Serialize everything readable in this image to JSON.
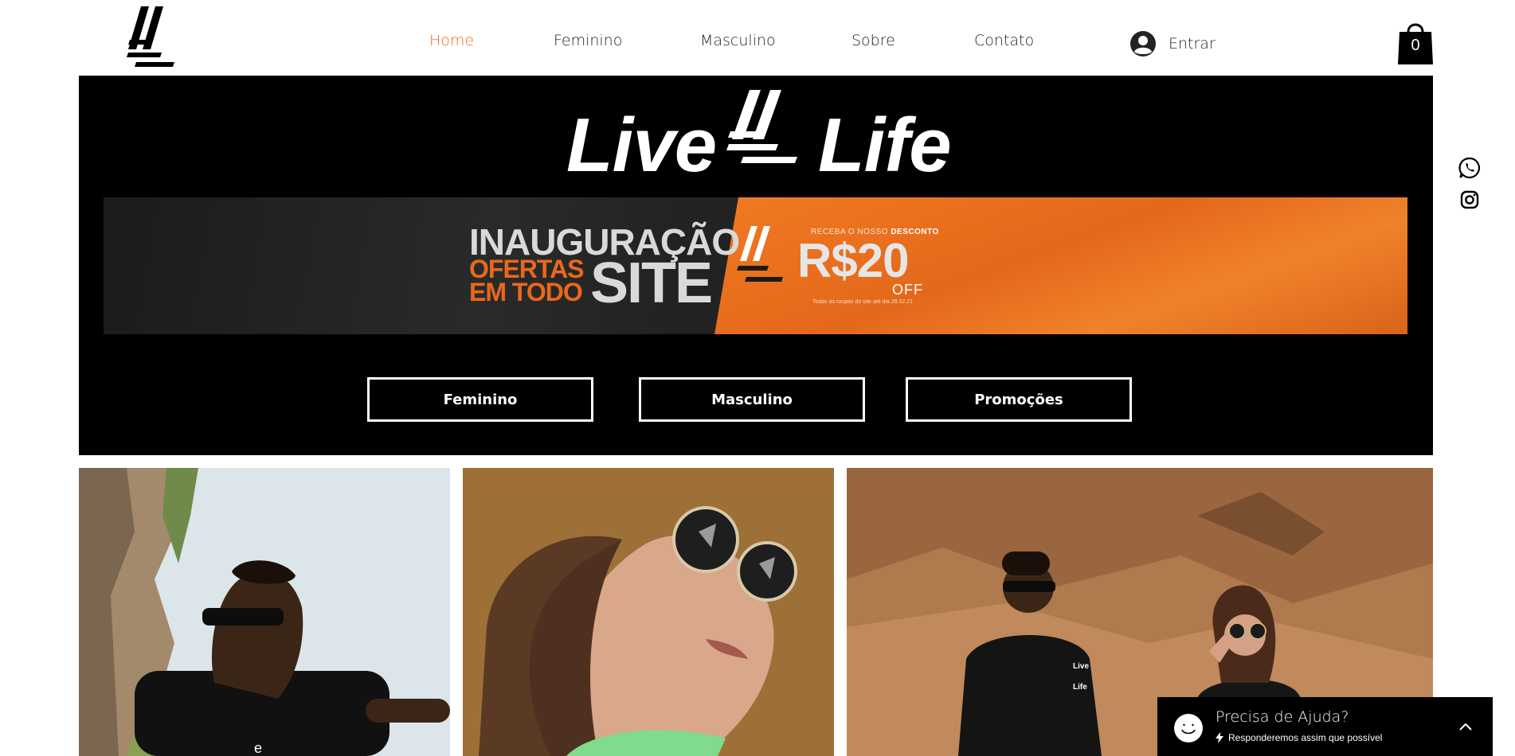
{
  "header": {
    "nav": [
      {
        "label": "Home",
        "active": true
      },
      {
        "label": "Feminino",
        "active": false
      },
      {
        "label": "Masculino",
        "active": false
      },
      {
        "label": "Sobre",
        "active": false
      },
      {
        "label": "Contato",
        "active": false
      }
    ],
    "login_label": "Entrar",
    "cart_count": "0",
    "accent_color": "#f26b1d"
  },
  "hero": {
    "brand_left": "Live",
    "brand_right": "Life",
    "banner": {
      "line1": "INAUGURAÇÃO",
      "line2": "OFERTAS",
      "line3": "EM TODO",
      "line4": "SITE",
      "receba": "RECEBA O NOSSO",
      "desconto": "DESCONTO",
      "price": "R$20",
      "off": "OFF",
      "fine_print": "Todas as roupas do site até dia 28.02.21"
    },
    "buttons": [
      {
        "label": "Feminino"
      },
      {
        "label": "Masculino"
      },
      {
        "label": "Promoções"
      }
    ]
  },
  "social": [
    {
      "icon": "whatsapp-icon"
    },
    {
      "icon": "instagram-icon"
    }
  ],
  "photos": [
    {
      "name": "photo-man-sunglasses"
    },
    {
      "name": "photo-woman-sunglasses"
    },
    {
      "name": "photo-couple-rocks"
    }
  ],
  "chat": {
    "title": "Precisa de Ajuda?",
    "subtitle": "Responderemos assim que possível"
  }
}
